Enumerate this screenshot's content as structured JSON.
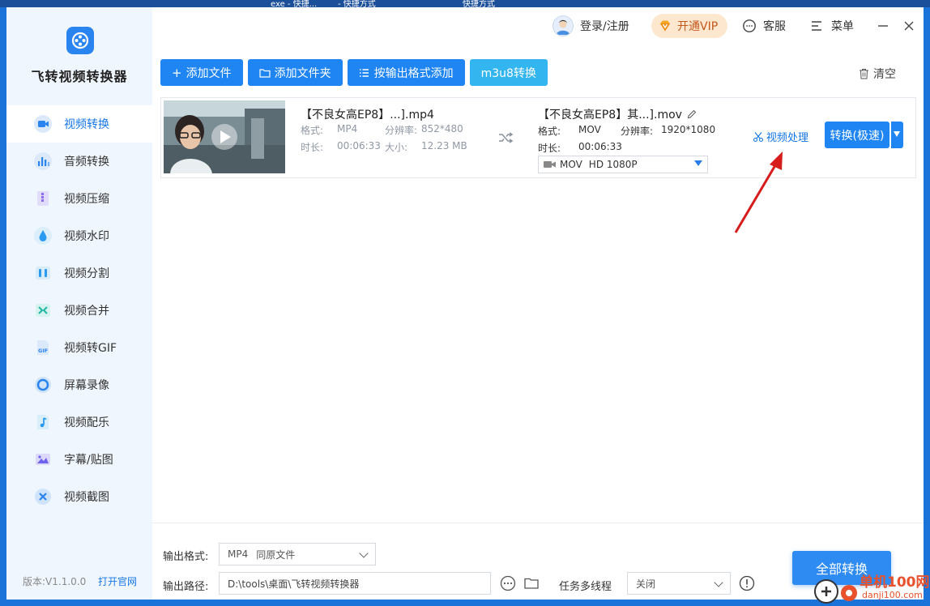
{
  "desktop": {
    "strip_texts": [
      "exe - 快捷...",
      "- 快捷方式",
      "快捷方式"
    ]
  },
  "app": {
    "name": "飞转视频转换器",
    "version": "版本:V1.1.0.0",
    "site_link": "打开官网",
    "brand_color": "#1f85f2"
  },
  "header": {
    "login": "登录/注册",
    "vip": "开通VIP",
    "service": "客服",
    "menu": "菜单"
  },
  "sidebar": {
    "items": [
      {
        "label": "视频转换",
        "icon": "video-convert-icon",
        "active": true
      },
      {
        "label": "音频转换",
        "icon": "audio-convert-icon"
      },
      {
        "label": "视频压缩",
        "icon": "video-compress-icon"
      },
      {
        "label": "视频水印",
        "icon": "watermark-icon"
      },
      {
        "label": "视频分割",
        "icon": "split-icon"
      },
      {
        "label": "视频合并",
        "icon": "merge-icon"
      },
      {
        "label": "视频转GIF",
        "icon": "gif-icon"
      },
      {
        "label": "屏幕录像",
        "icon": "record-icon"
      },
      {
        "label": "视频配乐",
        "icon": "music-icon"
      },
      {
        "label": "字幕/贴图",
        "icon": "subtitle-icon"
      },
      {
        "label": "视频截图",
        "icon": "screenshot-icon"
      }
    ]
  },
  "toolbar": {
    "add_file": "添加文件",
    "add_folder": "添加文件夹",
    "add_by_format": "按输出格式添加",
    "m3u8": "m3u8转换",
    "clear": "清空"
  },
  "file": {
    "source": {
      "name": "【不良女高EP8】...].mp4",
      "format_label": "格式:",
      "format": "MP4",
      "resolution_label": "分辨率:",
      "resolution": "852*480",
      "duration_label": "时长:",
      "duration": "00:06:33",
      "size_label": "大小:",
      "size": "12.23 MB"
    },
    "output": {
      "name": "【不良女高EP8】其...].mov",
      "format_label": "格式:",
      "format": "MOV",
      "resolution_label": "分辨率:",
      "resolution": "1920*1080",
      "duration_label": "时长:",
      "duration": "00:06:33",
      "preset_format": "MOV",
      "preset_quality": "HD 1080P"
    },
    "process_link": "视频处理",
    "convert_button": "转换(极速)"
  },
  "bottom": {
    "output_format_label": "输出格式:",
    "output_format_value": "MP4",
    "output_format_mode": "同原文件",
    "output_path_label": "输出路径:",
    "output_path_value": "D:\\tools\\桌面\\飞转视频转换器",
    "multithread_label": "任务多线程",
    "multithread_value": "关闭",
    "convert_all": "全部转换"
  },
  "watermark": {
    "site": "单机100网",
    "domain": "danji100.com"
  }
}
